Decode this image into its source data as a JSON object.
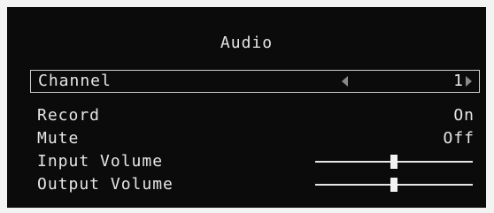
{
  "menu": {
    "title": "Audio",
    "channel": {
      "label": "Channel",
      "value": "1"
    },
    "record": {
      "label": "Record",
      "value": "On"
    },
    "mute": {
      "label": "Mute",
      "value": "Off"
    },
    "input_volume": {
      "label": "Input Volume",
      "level": 0.5
    },
    "output_volume": {
      "label": "Output Volume",
      "level": 0.5
    }
  }
}
